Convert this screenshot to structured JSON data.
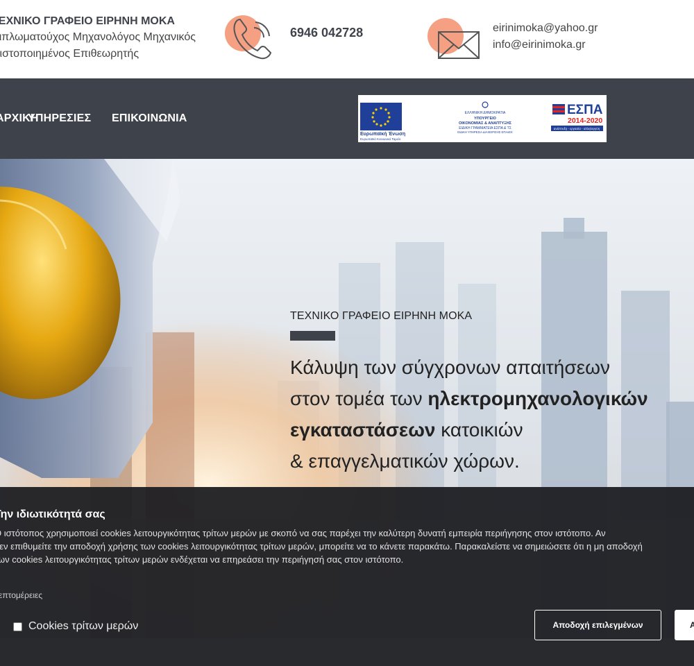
{
  "header": {
    "company_name": "ΤΕΧΝΙΚΟ ΓΡΑΦΕΙΟ ΕΙΡΗΝΗ ΜΟΚΑ",
    "title_line_1": "Διπλωματούχος Μηχανολόγος Μηχανικός",
    "title_line_2": "Πιστοποιημένος Επιθεωρητής",
    "phone": "6946 042728",
    "email_1": "eirinimoka@yahoo.gr",
    "email_2": "info@eirinimoka.gr",
    "accent_color": "#f6a083",
    "icons": [
      "phone-icon",
      "envelope-icon"
    ]
  },
  "nav": {
    "items": [
      {
        "label": "ΑΡΧΙΚΗ"
      },
      {
        "label": "ΥΠΗΡΕΣΙΕΣ"
      },
      {
        "label": "ΕΠΙΚΟΙΝΩΝΙΑ"
      }
    ],
    "background": "#3e434b"
  },
  "espa": {
    "eu_label": "Ευρωπαϊκή Ένωση",
    "eu_sub": "Ευρωπαϊκό Κοινωνικό Ταμείο",
    "gov_line_1": "ΕΛΛΗΝΙΚΗ ΔΗΜΟΚΡΑΤΙΑ",
    "gov_line_2": "ΥΠΟΥΡΓΕΙΟ",
    "gov_line_3": "ΟΙΚΟΝΟΜΙΑΣ & ΑΝΑΠΤΥΞΗΣ",
    "gov_line_4": "ΕΙΔΙΚΗ ΓΡΑΜΜΑΤΕΙΑ ΕΣΠΑ & ΤΣ",
    "gov_line_5": "ΕΙΔΙΚΗ ΥΠΗΡΕΣΙΑ ΔΙΑΧΕΙΡΙΣΗΣ ΕΠΑνΕΚ",
    "espa_label": "ΕΣΠΑ",
    "espa_years": "2014-2020",
    "espa_tagline": "ανάπτυξη - εργασία - αλληλεγγύη"
  },
  "hero": {
    "kicker": "ΤΕΧΝΙΚΟ ΓΡΑΦΕΙΟ ΕΙΡΗΝΗ ΜΟΚΑ",
    "line_1": "Κάλυψη των σύγχρονων απαιτήσεων",
    "line_2_pre": "στον τομέα των ",
    "line_2_bold": "ηλεκτρομηχανολογικών",
    "line_3_bold": "εγκαταστάσεων",
    "line_3_post": " κατοικιών",
    "line_4": "& επαγγελματικών χώρων."
  },
  "cookie": {
    "title": "Την ιδιωτικότητά σας",
    "text_line_1": "Ο ιστότοπος χρησιμοποιεί cookies λειτουργικότητας τρίτων μερών με σκοπό να σας παρέχει την καλύτερη δυνατή εμπειρία περιήγησης στον ιστότοπο. Αν",
    "text_line_2": "δεν επιθυμείτε την αποδοχή χρήσης των cookies λειτουργικότητας τρίτων μερών, μπορείτε να το κάνετε παρακάτω. Παρακαλείστε να σημειώσετε ότι η μη αποδοχή",
    "text_line_3": "των cookies λειτουργικότητας τρίτων μερών ενδέχεται να επηρεάσει την περιήγησή σας στον ιστότοπο.",
    "details_link": "Λεπτομέρειες",
    "checkbox_label": "Cookies τρίτων μερών",
    "checkbox_checked": false,
    "accept_selected_label": "Αποδοχή επιλεγμένων",
    "accept_all_label": "Αποδοχή όλων"
  }
}
